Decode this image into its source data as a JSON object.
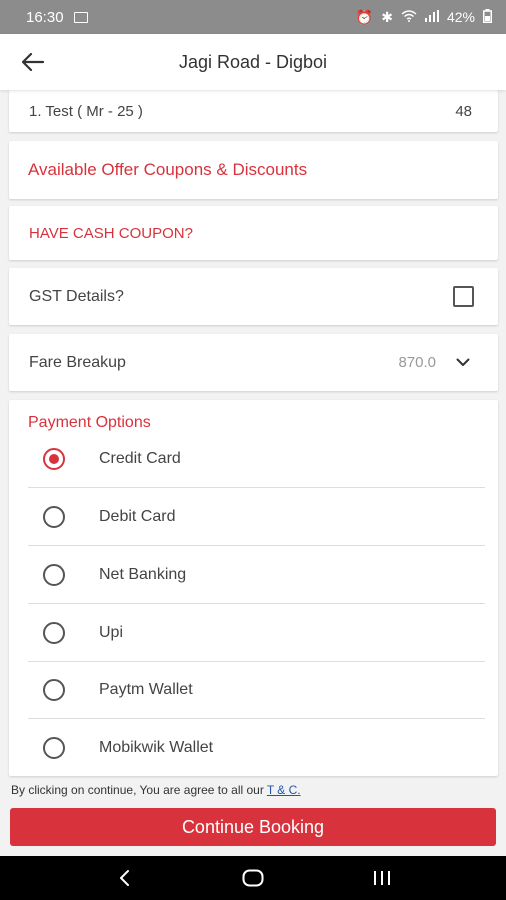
{
  "status_bar": {
    "time": "16:30",
    "right_text": "42%"
  },
  "header": {
    "title": "Jagi Road - Digboi"
  },
  "passenger": {
    "name": "1. Test ( Mr - 25 )",
    "seat": "48"
  },
  "offers": {
    "label": "Available Offer Coupons & Discounts"
  },
  "cash_coupon": {
    "label": "HAVE CASH COUPON?"
  },
  "gst": {
    "label": "GST Details?",
    "checked": false
  },
  "fare": {
    "label": "Fare Breakup",
    "amount": "870.0"
  },
  "payment": {
    "title": "Payment Options",
    "options": [
      {
        "label": "Credit Card",
        "selected": true
      },
      {
        "label": "Debit Card",
        "selected": false
      },
      {
        "label": "Net Banking",
        "selected": false
      },
      {
        "label": "Upi",
        "selected": false
      },
      {
        "label": "Paytm Wallet",
        "selected": false
      },
      {
        "label": "Mobikwik Wallet",
        "selected": false
      }
    ]
  },
  "terms": {
    "text": "By clicking on continue, You are agree to all our",
    "link": "T & C."
  },
  "continue_button": {
    "label": "Continue Booking"
  },
  "colors": {
    "accent": "#d8333d",
    "link": "#2255aa"
  },
  "icons": [
    "image-icon",
    "alarm-icon",
    "bluetooth-icon",
    "wifi-icon",
    "signal-icon",
    "battery-icon",
    "back-arrow-icon",
    "chevron-down-icon",
    "nav-back-icon",
    "nav-home-icon",
    "nav-recents-icon"
  ]
}
